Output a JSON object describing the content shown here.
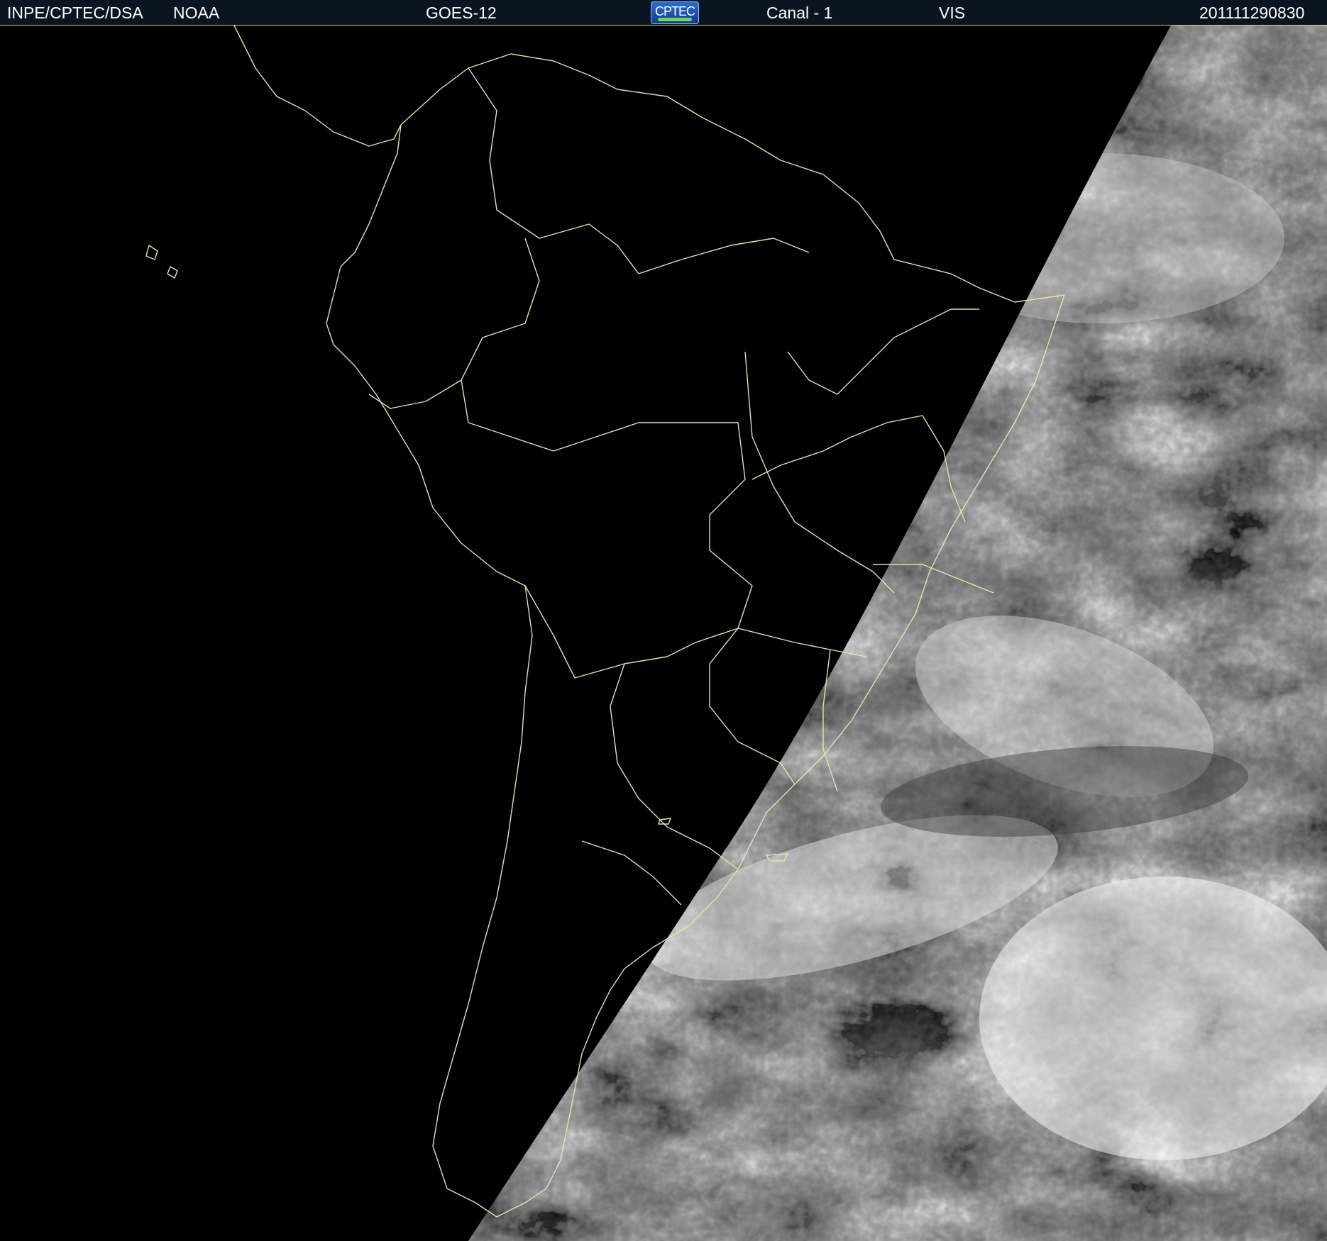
{
  "header": {
    "agency": "INPE/CPTEC/DSA",
    "provider": "NOAA",
    "satellite": "GOES-12",
    "logo_text": "CPTEC",
    "channel": "Canal - 1",
    "band": "VIS",
    "timestamp": "201111290830"
  },
  "colors": {
    "header_bg": "#0b1521",
    "boundaries": "#e6e2a8",
    "night_side": "#000000"
  }
}
